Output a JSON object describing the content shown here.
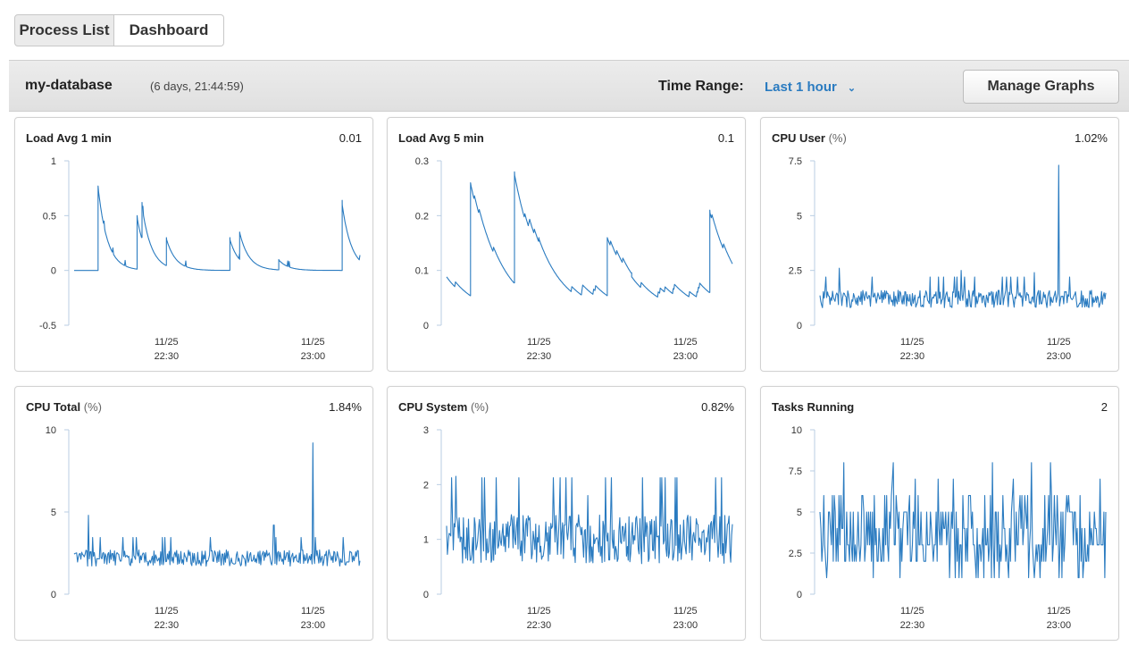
{
  "tabs": [
    {
      "label": "Process List",
      "active": false
    },
    {
      "label": "Dashboard",
      "active": true
    }
  ],
  "header": {
    "db_name": "my-database",
    "uptime": "(6 days, 21:44:59)",
    "time_range_label": "Time Range:",
    "time_range_value": "Last 1 hour",
    "manage_graphs_label": "Manage Graphs"
  },
  "colors": {
    "line": "#2a7bc0",
    "link": "#2a7bc0"
  },
  "icons": {
    "time_range_dropdown": "chevron-down-icon"
  },
  "panels": [
    {
      "title": "Load Avg 1 min",
      "unit": "",
      "value": "0.01"
    },
    {
      "title": "Load Avg 5 min",
      "unit": "",
      "value": "0.1"
    },
    {
      "title": "CPU User",
      "unit": "(%)",
      "value": "1.02%"
    },
    {
      "title": "CPU Total",
      "unit": "(%)",
      "value": "1.84%"
    },
    {
      "title": "CPU System",
      "unit": "(%)",
      "value": "0.82%"
    },
    {
      "title": "Tasks Running",
      "unit": "",
      "value": "2"
    }
  ],
  "chart_data": [
    {
      "type": "line",
      "title": "Load Avg 1 min",
      "ylim": [
        -0.5,
        1
      ],
      "yticks": [
        "1",
        "0.5",
        "0",
        "-0.5"
      ],
      "xticks": [
        {
          "date": "11/25",
          "time": "22:30"
        },
        {
          "date": "11/25",
          "time": "23:00"
        }
      ],
      "xrange": [
        "22:10",
        "23:10"
      ],
      "shape": "spikes",
      "peaks": [
        {
          "t": "22:16",
          "v": 0.77
        },
        {
          "t": "22:24",
          "v": 0.5
        },
        {
          "t": "22:25",
          "v": 0.62
        },
        {
          "t": "22:30",
          "v": 0.3
        },
        {
          "t": "22:43",
          "v": 0.3
        },
        {
          "t": "22:45",
          "v": 0.35
        },
        {
          "t": "22:53",
          "v": 0.1
        },
        {
          "t": "23:06",
          "v": 0.64
        }
      ],
      "baseline": 0
    },
    {
      "type": "line",
      "title": "Load Avg 5 min",
      "ylim": [
        0,
        0.3
      ],
      "yticks": [
        "0.3",
        "0.2",
        "0.1",
        "0"
      ],
      "xticks": [
        {
          "date": "11/25",
          "time": "22:30"
        },
        {
          "date": "11/25",
          "time": "23:00"
        }
      ],
      "xrange": [
        "22:10",
        "23:10"
      ],
      "shape": "sawtooth",
      "peaks": [
        {
          "t": "22:16",
          "v": 0.26
        },
        {
          "t": "22:25",
          "v": 0.28
        },
        {
          "t": "22:30",
          "v": 0.16
        },
        {
          "t": "22:44",
          "v": 0.16
        },
        {
          "t": "22:49",
          "v": 0.09
        },
        {
          "t": "23:05",
          "v": 0.21
        }
      ],
      "baseline": 0.02
    },
    {
      "type": "line",
      "title": "CPU User",
      "ylim": [
        0,
        7.5
      ],
      "yticks": [
        "7.5",
        "5",
        "2.5",
        "0"
      ],
      "xticks": [
        {
          "date": "11/25",
          "time": "22:30"
        },
        {
          "date": "11/25",
          "time": "23:00"
        }
      ],
      "xrange": [
        "22:10",
        "23:10"
      ],
      "shape": "noise",
      "mean": 1.2,
      "amplitude": 0.4,
      "spikes": [
        {
          "t": "23:00",
          "v": 7.3
        },
        {
          "t": "22:15",
          "v": 2.6
        },
        {
          "t": "22:40",
          "v": 2.5
        },
        {
          "t": "22:55",
          "v": 2.4
        }
      ]
    },
    {
      "type": "line",
      "title": "CPU Total",
      "ylim": [
        0,
        10
      ],
      "yticks": [
        "10",
        "5",
        "0"
      ],
      "xticks": [
        {
          "date": "11/25",
          "time": "22:30"
        },
        {
          "date": "11/25",
          "time": "23:00"
        }
      ],
      "xrange": [
        "22:10",
        "23:10"
      ],
      "shape": "noise",
      "mean": 2.2,
      "amplitude": 0.5,
      "spikes": [
        {
          "t": "23:00",
          "v": 9.2
        },
        {
          "t": "22:14",
          "v": 4.8
        },
        {
          "t": "22:52",
          "v": 4.2
        }
      ]
    },
    {
      "type": "line",
      "title": "CPU System",
      "ylim": [
        0,
        3
      ],
      "yticks": [
        "3",
        "2",
        "1",
        "0"
      ],
      "xticks": [
        {
          "date": "11/25",
          "time": "22:30"
        },
        {
          "date": "11/25",
          "time": "23:00"
        }
      ],
      "xrange": [
        "22:10",
        "23:10"
      ],
      "shape": "noise",
      "mean": 1.0,
      "amplitude": 0.45,
      "spikes": [
        {
          "t": "22:13",
          "v": 2.15
        },
        {
          "t": "22:40",
          "v": 1.8
        }
      ]
    },
    {
      "type": "line",
      "title": "Tasks Running",
      "ylim": [
        0,
        10
      ],
      "yticks": [
        "10",
        "7.5",
        "5",
        "2.5",
        "0"
      ],
      "xticks": [
        {
          "date": "11/25",
          "time": "22:30"
        },
        {
          "date": "11/25",
          "time": "23:00"
        }
      ],
      "xrange": [
        "22:10",
        "23:10"
      ],
      "shape": "discrete",
      "min": 1,
      "max": 8,
      "typical": [
        2,
        3,
        4,
        5
      ]
    }
  ]
}
